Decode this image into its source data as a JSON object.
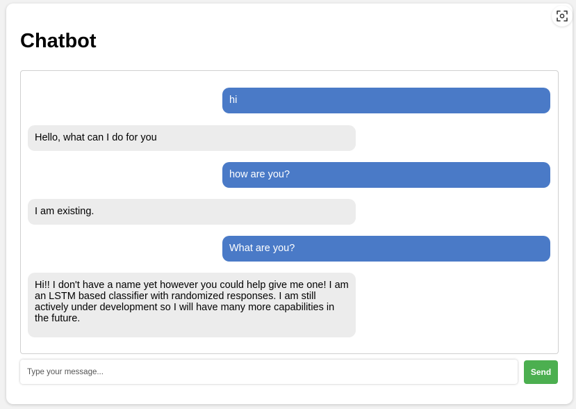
{
  "app": {
    "title": "Chatbot"
  },
  "messages": [
    {
      "sender": "user",
      "text": "hi"
    },
    {
      "sender": "bot",
      "text": "Hello, what can I do for you"
    },
    {
      "sender": "user",
      "text": "how are you?"
    },
    {
      "sender": "bot",
      "text": "I am existing."
    },
    {
      "sender": "user",
      "text": "What are you?"
    },
    {
      "sender": "bot",
      "text": "Hi!! I don't have a name yet however you could help give me one! I am an LSTM based classifier with randomized responses. I am still actively under development so I will have many more capabilities in the future."
    }
  ],
  "composer": {
    "placeholder": "Type your message...",
    "value": "",
    "send_label": "Send"
  },
  "colors": {
    "user_bubble": "#4a7ac7",
    "bot_bubble": "#ececec",
    "send_button": "#4caf50"
  },
  "icons": {
    "screenshot": "screenshot-icon"
  }
}
